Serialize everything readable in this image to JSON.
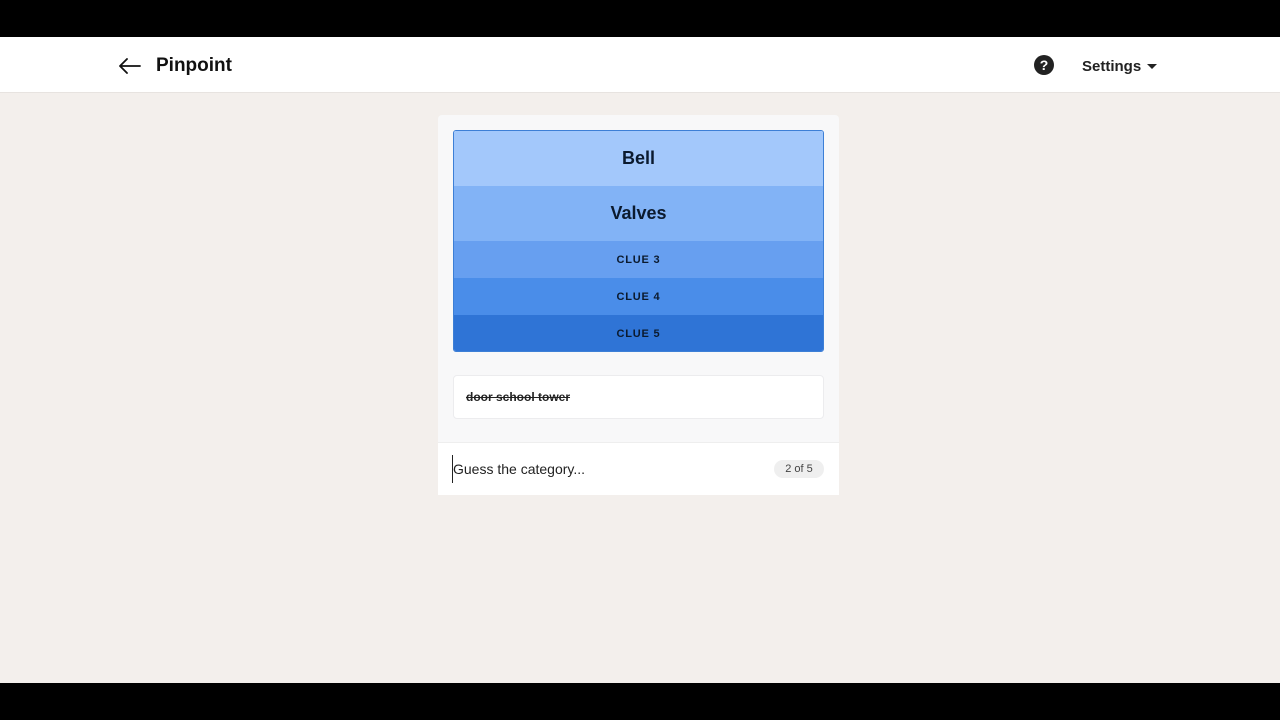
{
  "header": {
    "title": "Pinpoint",
    "help_glyph": "?",
    "settings_label": "Settings"
  },
  "clues": [
    {
      "label": "Bell",
      "revealed": true
    },
    {
      "label": "Valves",
      "revealed": true
    },
    {
      "label": "CLUE 3",
      "revealed": false
    },
    {
      "label": "CLUE 4",
      "revealed": false
    },
    {
      "label": "CLUE 5",
      "revealed": false
    }
  ],
  "wrong_guesses": [
    "door school tower"
  ],
  "guess": {
    "placeholder": "Guess the category...",
    "value": "",
    "counter": "2 of 5"
  },
  "colors": {
    "clue_1": "#a3c8fb",
    "clue_2": "#82b3f6",
    "clue_3": "#679ff0",
    "clue_4": "#4a8de9",
    "clue_5": "#2f74d6",
    "page_bg": "#f3efec"
  },
  "icons": {
    "back": "arrow-left-icon",
    "help": "question-circle-icon",
    "settings": "caret-down-icon"
  }
}
